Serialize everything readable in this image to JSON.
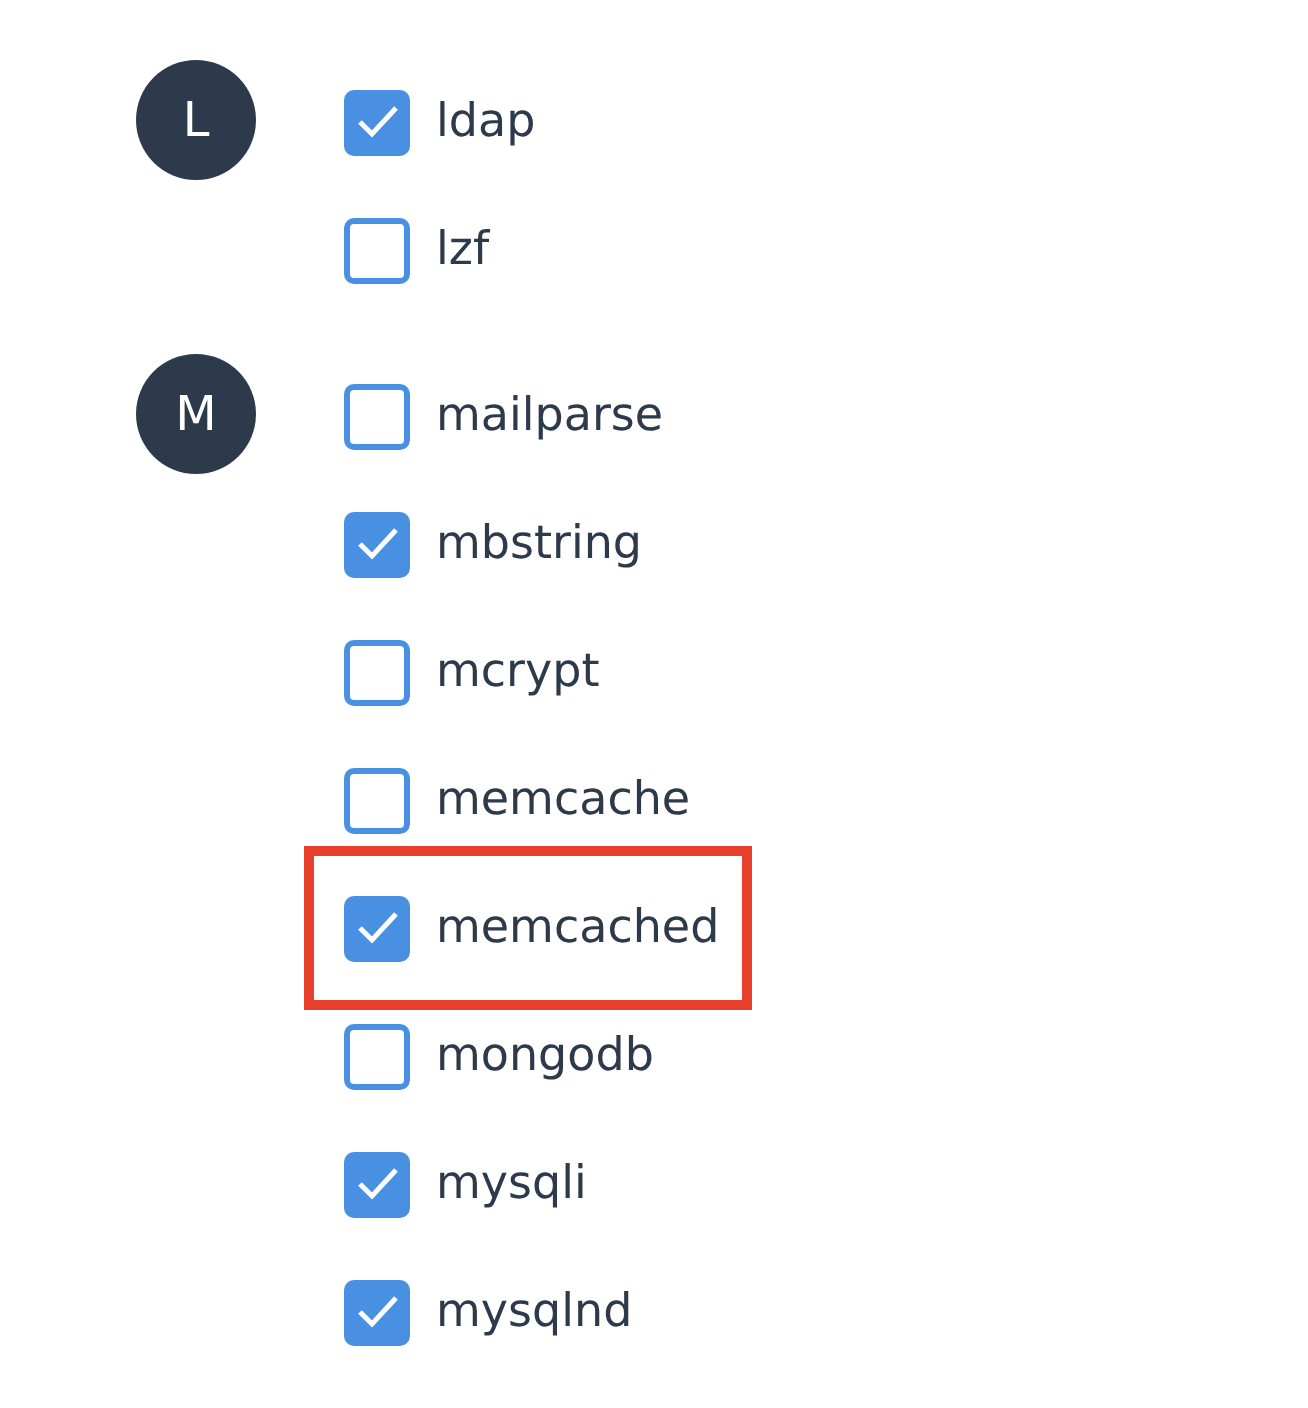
{
  "groups": [
    {
      "letter": "L",
      "items": [
        {
          "label": "ldap",
          "checked": true,
          "highlighted": false
        },
        {
          "label": "lzf",
          "checked": false,
          "highlighted": false
        }
      ]
    },
    {
      "letter": "M",
      "items": [
        {
          "label": "mailparse",
          "checked": false,
          "highlighted": false
        },
        {
          "label": "mbstring",
          "checked": true,
          "highlighted": false
        },
        {
          "label": "mcrypt",
          "checked": false,
          "highlighted": false
        },
        {
          "label": "memcache",
          "checked": false,
          "highlighted": false
        },
        {
          "label": "memcached",
          "checked": true,
          "highlighted": true
        },
        {
          "label": "mongodb",
          "checked": false,
          "highlighted": false
        },
        {
          "label": "mysqli",
          "checked": true,
          "highlighted": false
        },
        {
          "label": "mysqlnd",
          "checked": true,
          "highlighted": false
        }
      ]
    }
  ]
}
